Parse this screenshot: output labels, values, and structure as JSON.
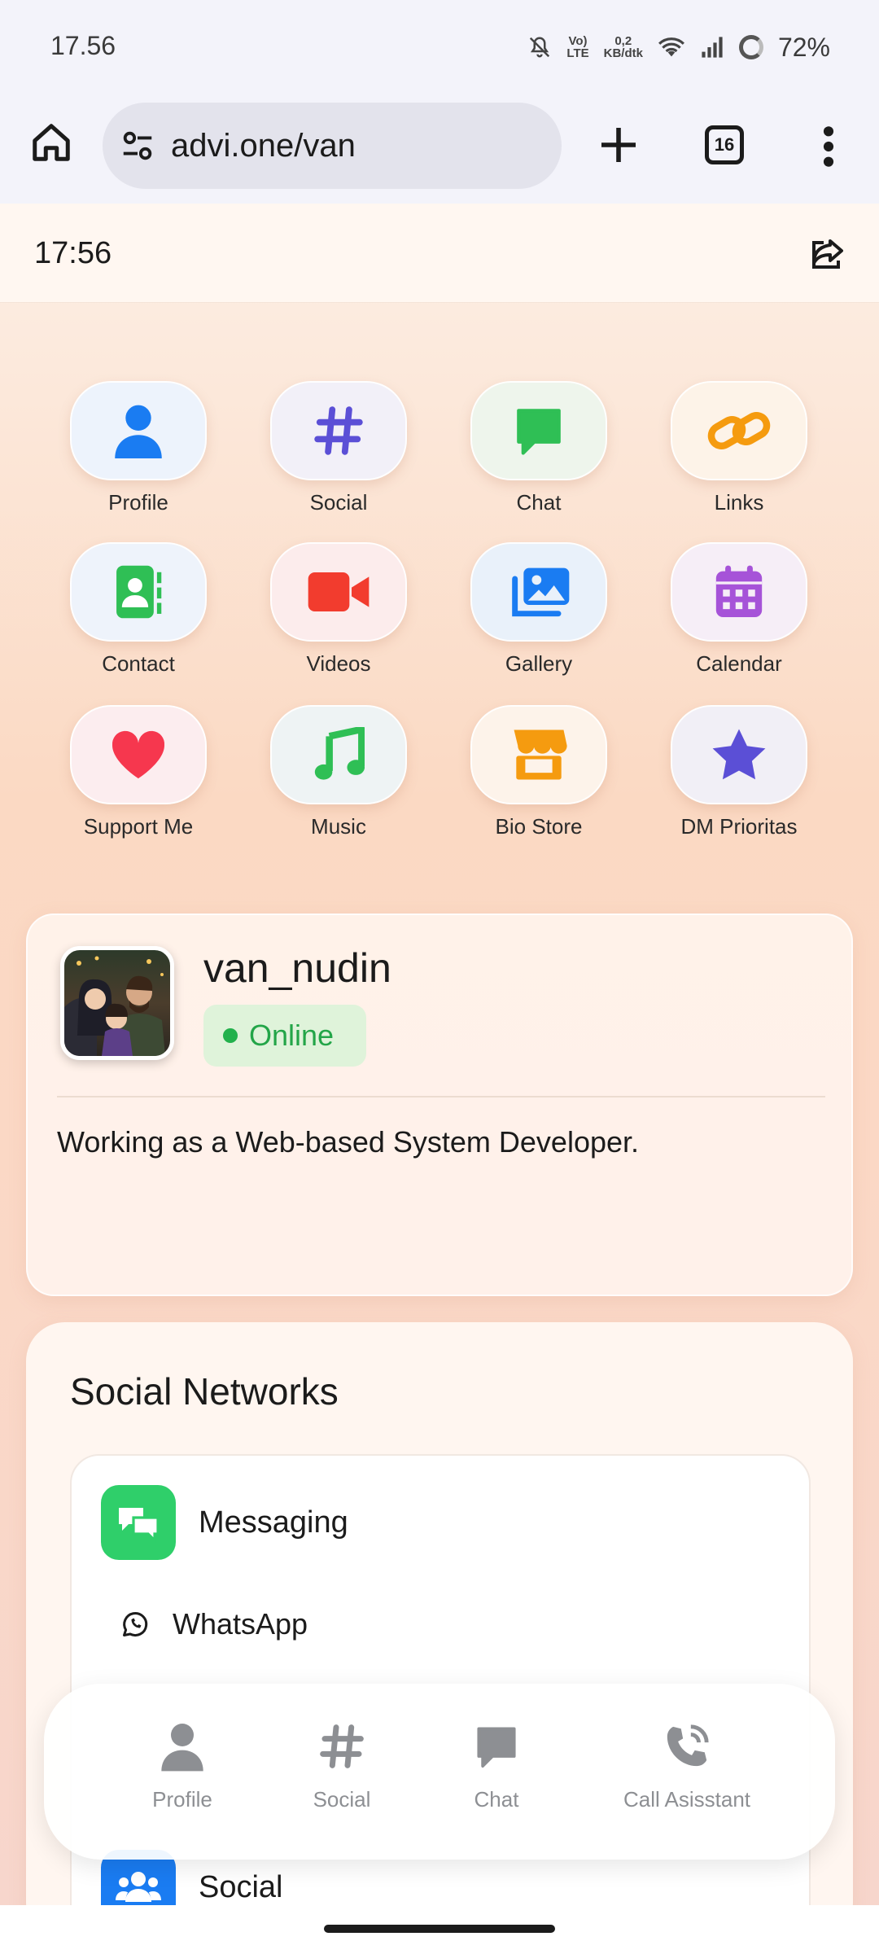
{
  "status_bar": {
    "time": "17.56",
    "network_label_top": "Vo)",
    "network_label_bottom": "LTE",
    "speed_top": "0,2",
    "speed_bottom": "KB/dtk",
    "battery": "72%"
  },
  "browser": {
    "url": "advi.one/van",
    "tab_count": "16"
  },
  "page_header": {
    "time": "17:56"
  },
  "apps": [
    {
      "label": "Profile",
      "icon": "person-icon",
      "color": "#1a7cf2"
    },
    {
      "label": "Social",
      "icon": "hashtag-icon",
      "color": "#5b4fd6"
    },
    {
      "label": "Chat",
      "icon": "chat-bubble-icon",
      "color": "#2fbf55"
    },
    {
      "label": "Links",
      "icon": "link-icon",
      "color": "#f59b0f"
    },
    {
      "label": "Contact",
      "icon": "contact-book-icon",
      "color": "#2fbf55"
    },
    {
      "label": "Videos",
      "icon": "video-camera-icon",
      "color": "#f23c2e"
    },
    {
      "label": "Gallery",
      "icon": "photo-gallery-icon",
      "color": "#1a7cf2"
    },
    {
      "label": "Calendar",
      "icon": "calendar-icon",
      "color": "#a653d8"
    },
    {
      "label": "Support Me",
      "icon": "heart-icon",
      "color": "#f6374e"
    },
    {
      "label": "Music",
      "icon": "music-note-icon",
      "color": "#2fbf55"
    },
    {
      "label": "Bio Store",
      "icon": "store-icon",
      "color": "#f59b0f"
    },
    {
      "label": "DM Prioritas",
      "icon": "star-icon",
      "color": "#5b4fd6"
    }
  ],
  "profile": {
    "username": "van_nudin",
    "status": "Online",
    "bio": "Working as a Web-based System Developer."
  },
  "social_networks": {
    "title": "Social Networks",
    "categories": [
      {
        "label": "Messaging",
        "icon": "chat-bubbles-icon",
        "color": "#2fcf6a",
        "items": [
          {
            "label": "WhatsApp",
            "icon": "whatsapp-icon"
          }
        ]
      },
      {
        "label": "Social",
        "icon": "users-icon",
        "color": "#1a7cf2"
      }
    ]
  },
  "bottom_nav": [
    {
      "label": "Profile",
      "icon": "person-icon"
    },
    {
      "label": "Social",
      "icon": "hashtag-icon"
    },
    {
      "label": "Chat",
      "icon": "chat-bubble-icon"
    },
    {
      "label": "Call Asisstant",
      "icon": "phone-call-icon"
    }
  ]
}
